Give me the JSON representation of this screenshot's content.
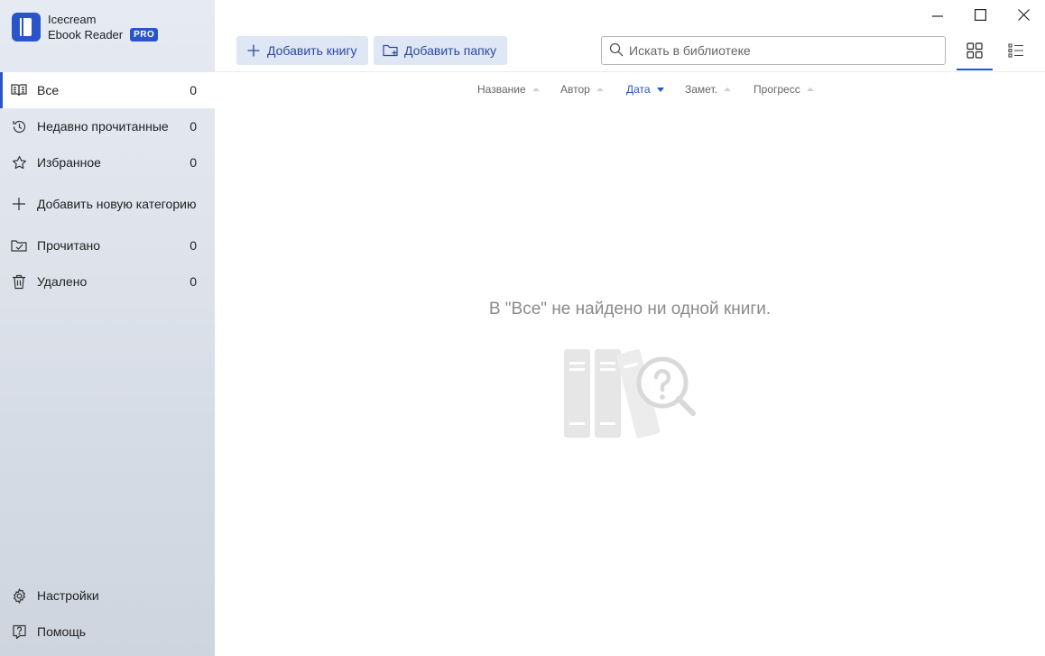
{
  "app": {
    "name_line1": "Icecream",
    "name_line2": "Ebook Reader",
    "badge": "PRO",
    "accent_color": "#2a55c9"
  },
  "sidebar": {
    "items": [
      {
        "label": "Все",
        "count": "0",
        "icon": "book-open-icon",
        "active": true
      },
      {
        "label": "Недавно прочитанные",
        "count": "0",
        "icon": "history-icon"
      },
      {
        "label": "Избранное",
        "count": "0",
        "icon": "star-icon"
      },
      {
        "label": "Добавить новую категорию",
        "icon": "plus-icon"
      },
      {
        "label": "Прочитано",
        "count": "0",
        "icon": "folder-check-icon"
      },
      {
        "label": "Удалено",
        "count": "0",
        "icon": "trash-icon"
      }
    ],
    "bottom": [
      {
        "label": "Настройки",
        "icon": "gear-icon"
      },
      {
        "label": "Помощь",
        "icon": "help-icon"
      }
    ]
  },
  "toolbar": {
    "add_book_label": "Добавить книгу",
    "add_folder_label": "Добавить папку",
    "search_placeholder": "Искать в библиотеке",
    "search_value": ""
  },
  "sort": {
    "columns": [
      {
        "label": "Название",
        "active": false
      },
      {
        "label": "Автор",
        "active": false
      },
      {
        "label": "Дата",
        "active": true
      },
      {
        "label": "Замет.",
        "active": false
      },
      {
        "label": "Прогресс",
        "active": false
      }
    ]
  },
  "empty_state": {
    "message": "В \"Все\" не найдено ни одной книги."
  }
}
